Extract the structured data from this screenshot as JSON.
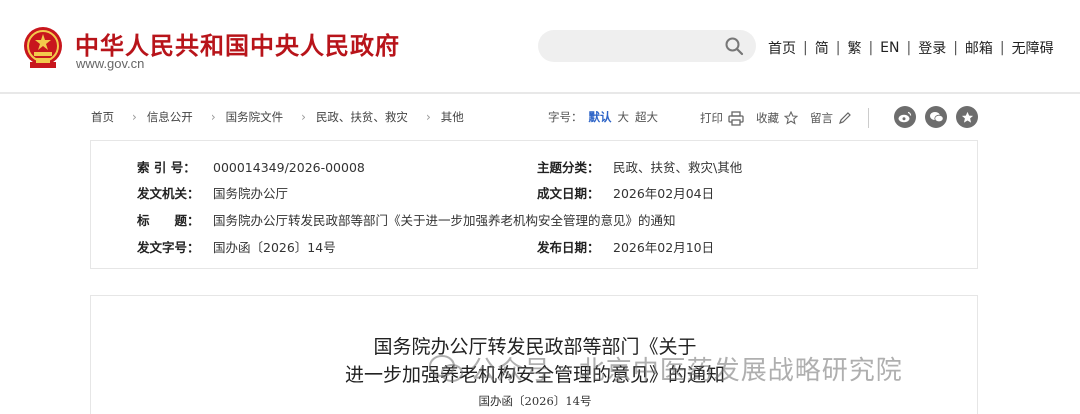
{
  "header": {
    "title": "中华人民共和国中央人民政府",
    "url": "www.gov.cn",
    "search_placeholder": "",
    "nav": [
      "首页",
      "简",
      "繁",
      "EN",
      "登录",
      "邮箱",
      "无障碍"
    ],
    "accent_color": "#b8141a"
  },
  "breadcrumb": {
    "items": [
      "首页",
      "信息公开",
      "国务院文件",
      "民政、扶贫、救灾",
      "其他"
    ]
  },
  "font_size": {
    "label": "字号：",
    "options": [
      "默认",
      "大",
      "超大"
    ],
    "selected": "默认"
  },
  "tools": {
    "print": "打印",
    "favorite": "收藏",
    "comment": "留言"
  },
  "share_icons": [
    "weibo-icon",
    "wechat-icon",
    "qzone-icon"
  ],
  "info": {
    "index_label": "索 引 号：",
    "index_value": "000014349/2026-00008",
    "category_label": "主题分类：",
    "category_value": "民政、扶贫、救灾\\其他",
    "issuer_label": "发文机关：",
    "issuer_value": "国务院办公厅",
    "created_label": "成文日期：",
    "created_value": "2026年02月04日",
    "title_label": "标　　题：",
    "title_value": "国务院办公厅转发民政部等部门《关于进一步加强养老机构安全管理的意见》的通知",
    "docno_label": "发文字号：",
    "docno_value": "国办函〔2026〕14号",
    "published_label": "发布日期：",
    "published_value": "2026年02月10日"
  },
  "article": {
    "title_line1": "国务院办公厅转发民政部等部门《关于",
    "title_line2": "进一步加强养老机构安全管理的意见》的通知",
    "doc_number": "国办函〔2026〕14号"
  },
  "watermark": {
    "text": "公众号 · 北京中医药发展战略研究院"
  }
}
